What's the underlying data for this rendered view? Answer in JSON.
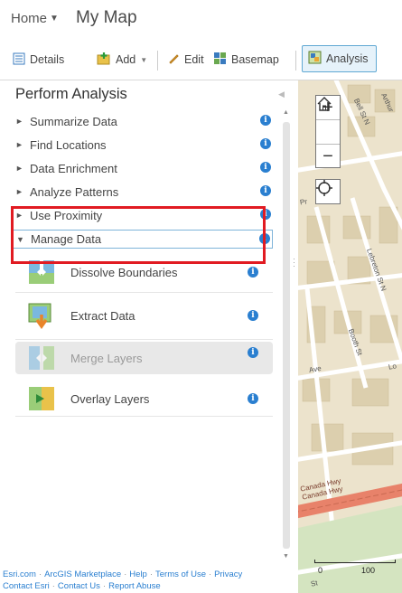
{
  "header": {
    "home_label": "Home",
    "map_title": "My Map"
  },
  "toolbar": {
    "details_label": "Details",
    "add_label": "Add",
    "edit_label": "Edit",
    "basemap_label": "Basemap",
    "analysis_label": "Analysis"
  },
  "panel": {
    "title": "Perform Analysis",
    "categories": [
      {
        "label": "Summarize Data"
      },
      {
        "label": "Find Locations"
      },
      {
        "label": "Data Enrichment"
      },
      {
        "label": "Analyze Patterns"
      },
      {
        "label": "Use Proximity"
      },
      {
        "label": "Manage Data"
      }
    ],
    "tools": [
      {
        "label": "Dissolve Boundaries"
      },
      {
        "label": "Extract Data"
      },
      {
        "label": "Merge Layers"
      },
      {
        "label": "Overlay Layers"
      }
    ],
    "info_glyph": "i"
  },
  "map": {
    "streets": [
      "Bell St N",
      "Arthur",
      "Lebreton St N",
      "Booth St",
      "Ave",
      "Lo",
      "Canada Hwy",
      "Canada Hwy",
      "St",
      "Pr"
    ],
    "scale": {
      "start": "0",
      "end": "100"
    }
  },
  "footer": {
    "links_row1": [
      "Esri.com",
      "ArcGIS Marketplace",
      "Help",
      "Terms of Use",
      "Privacy"
    ],
    "links_row2": [
      "Contact Esri",
      "Contact Us",
      "Report Abuse"
    ]
  },
  "colors": {
    "highlight": "#e11b22",
    "accent": "#2a7fd0",
    "map_base": "#ece3cc",
    "highway": "#e8826a"
  }
}
